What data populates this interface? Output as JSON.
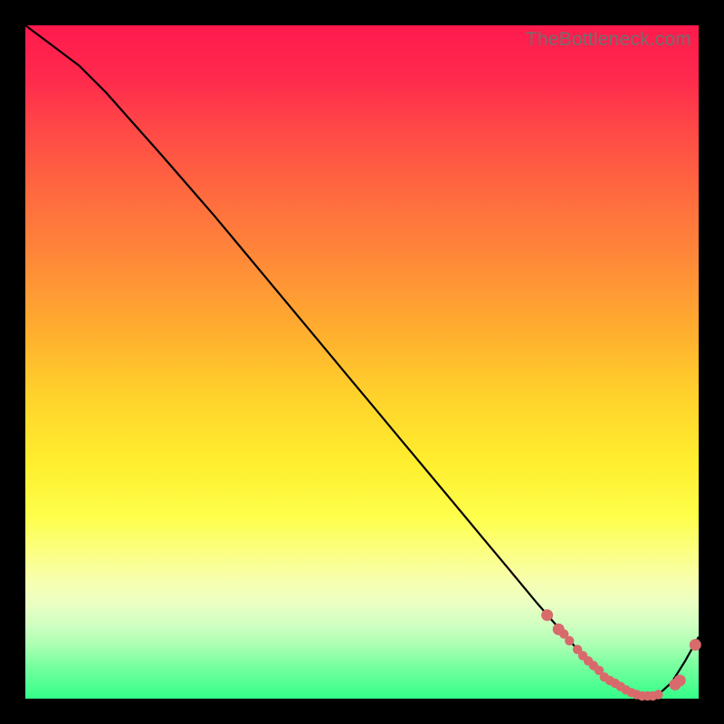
{
  "watermark": "TheBottleneck.com",
  "chart_data": {
    "type": "line",
    "title": "",
    "xlabel": "",
    "ylabel": "",
    "xlim": [
      0,
      100
    ],
    "ylim": [
      0,
      100
    ],
    "grid": false,
    "legend": false,
    "series": [
      {
        "name": "curve",
        "x": [
          0,
          4,
          8,
          12,
          16,
          20,
          24,
          28,
          32,
          36,
          40,
          44,
          48,
          52,
          56,
          60,
          64,
          68,
          72,
          76,
          80,
          82,
          84,
          86,
          88,
          90,
          92,
          94,
          96,
          98,
          100
        ],
        "y": [
          100,
          97,
          94,
          90,
          85.5,
          81,
          76.4,
          71.8,
          67,
          62.2,
          57.4,
          52.6,
          47.8,
          43,
          38.2,
          33.4,
          28.6,
          23.8,
          19,
          14.2,
          9.6,
          7.3,
          5.1,
          3.2,
          1.8,
          0.9,
          0.4,
          0.6,
          2.4,
          5.6,
          9.2
        ]
      }
    ],
    "markers": {
      "name": "segment-dots",
      "color": "#d86a6c",
      "points_x": [
        77.5,
        79.2,
        80.0,
        80.8,
        82.0,
        82.8,
        83.6,
        84.4,
        85.2,
        86.0,
        86.8,
        87.6,
        88.4,
        89.2,
        90.0,
        90.8,
        91.6,
        92.4,
        93.2,
        94.0,
        96.5,
        97.2,
        99.5
      ],
      "points_y": [
        12.4,
        10.3,
        9.6,
        8.6,
        7.3,
        6.4,
        5.6,
        4.9,
        4.2,
        3.2,
        2.7,
        2.3,
        1.8,
        1.3,
        0.9,
        0.6,
        0.4,
        0.4,
        0.4,
        0.6,
        2.1,
        2.7,
        8.0
      ]
    },
    "gradient_stops": [
      {
        "pos": 0.0,
        "color": "#ff1a4d"
      },
      {
        "pos": 0.15,
        "color": "#ff4747"
      },
      {
        "pos": 0.35,
        "color": "#ff8a38"
      },
      {
        "pos": 0.55,
        "color": "#ffd22b"
      },
      {
        "pos": 0.73,
        "color": "#feff4a"
      },
      {
        "pos": 0.86,
        "color": "#eaffc3"
      },
      {
        "pos": 1.0,
        "color": "#33ff88"
      }
    ]
  }
}
